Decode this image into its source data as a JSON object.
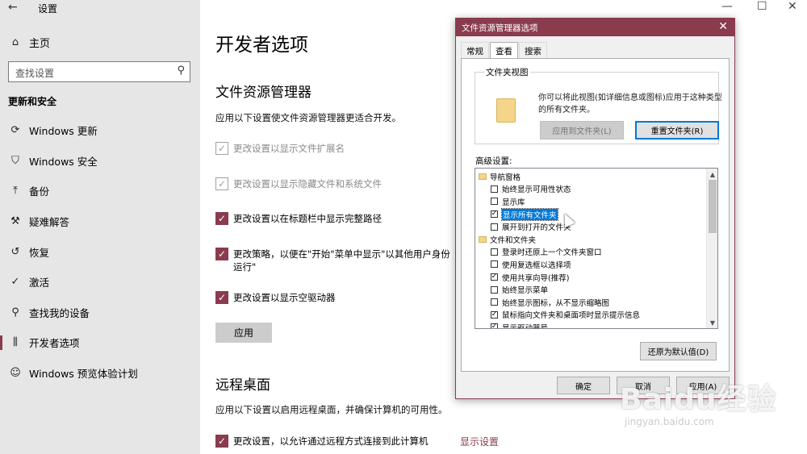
{
  "window": {
    "title": "设置",
    "back_glyph": "←",
    "min_glyph": "—",
    "max_glyph": "☐",
    "close_glyph": "✕"
  },
  "sidebar": {
    "home_label": "主页",
    "search_placeholder": "查找设置",
    "section_title": "更新和安全",
    "items": [
      {
        "label": "Windows 更新",
        "icon": "sync-icon",
        "glyph": "⟳"
      },
      {
        "label": "Windows 安全",
        "icon": "shield-icon",
        "glyph": "⛉"
      },
      {
        "label": "备份",
        "icon": "backup-icon",
        "glyph": "⤒"
      },
      {
        "label": "疑难解答",
        "icon": "wrench-icon",
        "glyph": "⚒"
      },
      {
        "label": "恢复",
        "icon": "history-icon",
        "glyph": "↺"
      },
      {
        "label": "激活",
        "icon": "check-circle-icon",
        "glyph": "✓"
      },
      {
        "label": "查找我的设备",
        "icon": "person-pin-icon",
        "glyph": "⚲"
      },
      {
        "label": "开发者选项",
        "icon": "developer-icon",
        "glyph": "⫼"
      },
      {
        "label": "Windows 预览体验计划",
        "icon": "insider-icon",
        "glyph": "☺"
      }
    ],
    "active_index": 7
  },
  "main": {
    "page_title": "开发者选项",
    "explorer": {
      "heading": "文件资源管理器",
      "description": "应用以下设置使文件资源管理器更适合开发。",
      "options": [
        {
          "text": "更改设置以显示文件扩展名",
          "checked": true,
          "disabled": true
        },
        {
          "text": "更改设置以显示隐藏文件和系统文件",
          "checked": true,
          "disabled": true
        },
        {
          "text": "更改设置以在标题栏中显示完整路径",
          "checked": true,
          "disabled": false
        },
        {
          "text": "更改策略，以便在\"开始\"菜单中显示\"以其他用户身份运行\"",
          "checked": true,
          "disabled": false
        },
        {
          "text": "更改设置以显示空驱动器",
          "checked": true,
          "disabled": false
        }
      ],
      "apply_label": "应用"
    },
    "remote": {
      "heading": "远程桌面",
      "description": "应用以下设置以启用远程桌面，并确保计算机的可用性。",
      "option_text": "更改设置，以允许通过远程方式连接到此计算机",
      "show_settings_link": "显示设置"
    }
  },
  "dialog": {
    "title": "文件资源管理器选项",
    "close_glyph": "✕",
    "tabs": [
      "常规",
      "查看",
      "搜索"
    ],
    "selected_tab": 1,
    "folder_view": {
      "group_label": "文件夹视图",
      "text": "你可以将此视图(如详细信息或图标)应用于这种类型的所有文件夹。",
      "apply_to_folders": "应用到文件夹(L)",
      "reset_folders": "重置文件夹(R)"
    },
    "advanced_label": "高级设置:",
    "tree": [
      {
        "type": "category",
        "text": "导航窗格"
      },
      {
        "type": "option",
        "text": "始终显示可用性状态",
        "checked": false
      },
      {
        "type": "option",
        "text": "显示库",
        "checked": false
      },
      {
        "type": "option",
        "text": "显示所有文件夹",
        "checked": true,
        "selected": true
      },
      {
        "type": "option",
        "text": "展开到打开的文件夹",
        "checked": false
      },
      {
        "type": "category",
        "text": "文件和文件夹"
      },
      {
        "type": "option",
        "text": "登录时还原上一个文件夹窗口",
        "checked": false
      },
      {
        "type": "option",
        "text": "使用复选框以选择项",
        "checked": false
      },
      {
        "type": "option",
        "text": "使用共享向导(推荐)",
        "checked": true
      },
      {
        "type": "option",
        "text": "始终显示菜单",
        "checked": false
      },
      {
        "type": "option",
        "text": "始终显示图标，从不显示缩略图",
        "checked": false
      },
      {
        "type": "option",
        "text": "鼠标指向文件夹和桌面项时显示提示信息",
        "checked": true
      },
      {
        "type": "option",
        "text": "显示驱动器号",
        "checked": true
      }
    ],
    "restore_defaults": "还原为默认值(D)",
    "ok_label": "确定",
    "cancel_label": "取消",
    "apply_label": "应用(A)"
  },
  "watermark": {
    "brand": "Baidu经验",
    "url": "jingyan.baidu.com"
  }
}
